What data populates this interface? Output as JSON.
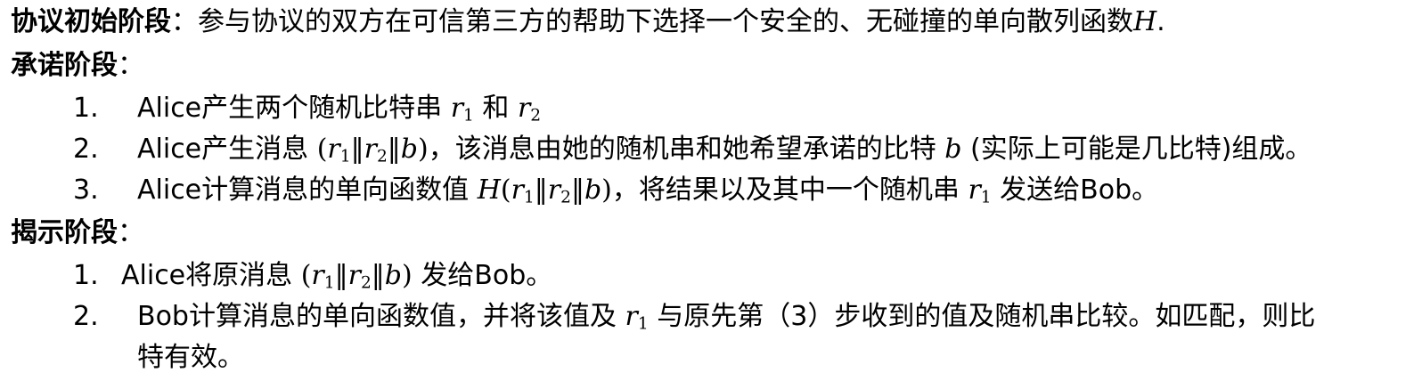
{
  "sections": {
    "init": {
      "heading": "协议初始阶段",
      "colon": "：",
      "text": "参与协议的双方在可信第三方的帮助下选择一个安全的、无碰撞的单向散列函数",
      "fn": "H",
      "end": "."
    },
    "commit": {
      "heading": "承诺阶段",
      "colon": "：",
      "steps": [
        {
          "num": "1.",
          "t1": "Alice产生两个随机比特串 ",
          "t2": " 和 "
        },
        {
          "num": "2.",
          "t1": "Alice产生消息 ",
          "t2": "，该消息由她的随机串和她希望承诺的比特 ",
          "t3": " (实际上可能是几比特)组成。"
        },
        {
          "num": "3.",
          "t1": "Alice计算消息的单向函数值 ",
          "t2": "，将结果以及其中一个随机串 ",
          "t3": " 发送给Bob。"
        }
      ]
    },
    "reveal": {
      "heading": "揭示阶段",
      "colon": "：",
      "steps": [
        {
          "num": "1.",
          "t1": "Alice将原消息 ",
          "t2": " 发给Bob。"
        },
        {
          "num": "2.",
          "t1": "Bob计算消息的单向函数值，并将该值及 ",
          "t2": " 与原先第（3）步收到的值及随机串比较。如匹配，则比",
          "t3": "特有效。"
        }
      ]
    }
  },
  "math": {
    "r": "r",
    "sub1": "1",
    "sub2": "2",
    "open": "(",
    "close": ")",
    "concat": "‖",
    "b": "b",
    "H": "H"
  }
}
